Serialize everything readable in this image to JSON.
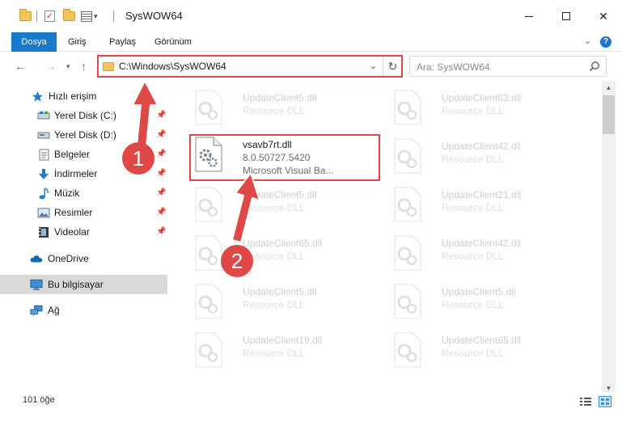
{
  "window": {
    "title": "SysWOW64"
  },
  "ribbon": {
    "tabs": [
      "Dosya",
      "Giriş",
      "Paylaş",
      "Görünüm"
    ]
  },
  "address": {
    "path": "C:\\Windows\\SysWOW64"
  },
  "search": {
    "placeholder": "Ara: SysWOW64"
  },
  "sidebar": {
    "quick_access": "Hızlı erişim",
    "items": [
      {
        "label": "Yerel Disk (C:)",
        "icon": "drive-icon",
        "pinned": true
      },
      {
        "label": "Yerel Disk (D:)",
        "icon": "drive-icon",
        "pinned": true
      },
      {
        "label": "Belgeler",
        "icon": "documents-icon",
        "pinned": true
      },
      {
        "label": "İndirmeler",
        "icon": "download-icon",
        "pinned": true
      },
      {
        "label": "Müzik",
        "icon": "music-icon",
        "pinned": true
      },
      {
        "label": "Resimler",
        "icon": "pictures-icon",
        "pinned": true
      },
      {
        "label": "Videolar",
        "icon": "videos-icon",
        "pinned": true
      }
    ],
    "onedrive": "OneDrive",
    "this_pc": "Bu bilgisayar",
    "network": "Ağ"
  },
  "files": {
    "highlighted": {
      "name": "vsavb7rt.dll",
      "version": "8.0.50727.5420",
      "description": "Microsoft Visual Ba..."
    },
    "background": [
      {
        "name": "UpdateClient5.dll",
        "type": "Resource DLL"
      },
      {
        "name": "UpdateClient63.dll",
        "type": "Resource DLL"
      },
      {
        "name": "UpdateClient42.dll",
        "type": "Resource DLL"
      },
      {
        "name": "UpdateClient5.dll",
        "type": "Resource DLL"
      },
      {
        "name": "UpdateClient21.dll",
        "type": "Resource DLL"
      },
      {
        "name": "UpdateClient65.dll",
        "type": "Resource DLL"
      },
      {
        "name": "UpdateClient42.dll",
        "type": "Resource DLL"
      },
      {
        "name": "UpdateClient5.dll",
        "type": "Resource DLL"
      },
      {
        "name": "UpdateClient5.dll",
        "type": "Resource DLL"
      },
      {
        "name": "UpdateClient19.dll",
        "type": "Resource DLL"
      },
      {
        "name": "UpdateClient65.dll",
        "type": "Resource DLL"
      }
    ]
  },
  "status": {
    "item_count": "101 öğe"
  },
  "annotations": {
    "step1": "1",
    "step2": "2",
    "color": "#e04848"
  },
  "colors": {
    "accent": "#1979ca",
    "selection": "#d9d9d9"
  }
}
